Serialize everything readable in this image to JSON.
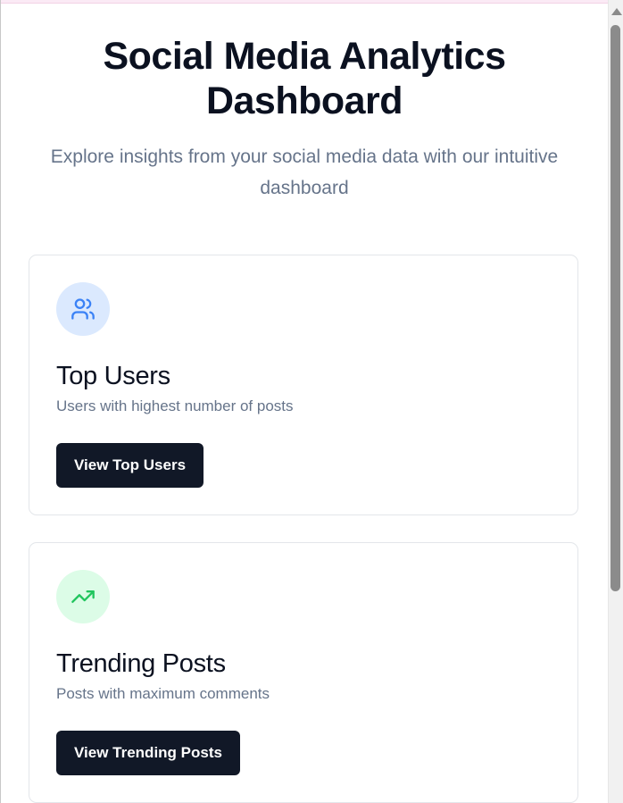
{
  "hero": {
    "title": "Social Media Analytics Dashboard",
    "subtitle": "Explore insights from your social media data with our intuitive dashboard"
  },
  "cards": [
    {
      "icon": "users-icon",
      "icon_color": "#3b82f6",
      "icon_bg": "#dbe9fe",
      "title": "Top Users",
      "description": "Users with highest number of posts",
      "button_label": "View Top Users"
    },
    {
      "icon": "trending-up-icon",
      "icon_color": "#22c55e",
      "icon_bg": "#dcfce7",
      "title": "Trending Posts",
      "description": "Posts with maximum comments",
      "button_label": "View Trending Posts"
    }
  ],
  "colors": {
    "primary_text": "#0b1120",
    "muted_text": "#66748a",
    "button_bg": "#111827",
    "button_text": "#ffffff",
    "card_border": "#e3e6ea"
  }
}
